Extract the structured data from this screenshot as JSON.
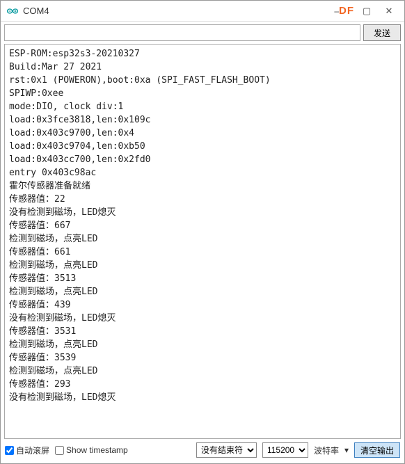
{
  "window": {
    "title": "COM4",
    "df_logo": "DF",
    "minimize": "–",
    "maximize": "▢",
    "close": "✕"
  },
  "input": {
    "value": "",
    "placeholder": "",
    "send_label": "发送"
  },
  "output_lines": [
    "ESP-ROM:esp32s3-20210327",
    "Build:Mar 27 2021",
    "rst:0x1 (POWERON),boot:0xa (SPI_FAST_FLASH_BOOT)",
    "SPIWP:0xee",
    "mode:DIO, clock div:1",
    "load:0x3fce3818,len:0x109c",
    "load:0x403c9700,len:0x4",
    "load:0x403c9704,len:0xb50",
    "load:0x403cc700,len:0x2fd0",
    "entry 0x403c98ac",
    "霍尔传感器准备就绪",
    "传感器值：22",
    "没有检测到磁场，LED熄灭",
    "传感器值：667",
    "检测到磁场，点亮LED",
    "传感器值：661",
    "检测到磁场，点亮LED",
    "传感器值：3513",
    "检测到磁场，点亮LED",
    "传感器值：439",
    "没有检测到磁场，LED熄灭",
    "传感器值：3531",
    "检测到磁场，点亮LED",
    "传感器值：3539",
    "检测到磁场，点亮LED",
    "传感器值：293",
    "没有检测到磁场，LED熄灭"
  ],
  "bottom": {
    "autoscroll_label": "自动滚屏",
    "autoscroll_checked": true,
    "timestamp_label": "Show timestamp",
    "timestamp_checked": false,
    "line_ending_selected": "没有结束符",
    "baud_selected": "115200",
    "baud_label": "波特率",
    "clear_label": "清空输出"
  }
}
